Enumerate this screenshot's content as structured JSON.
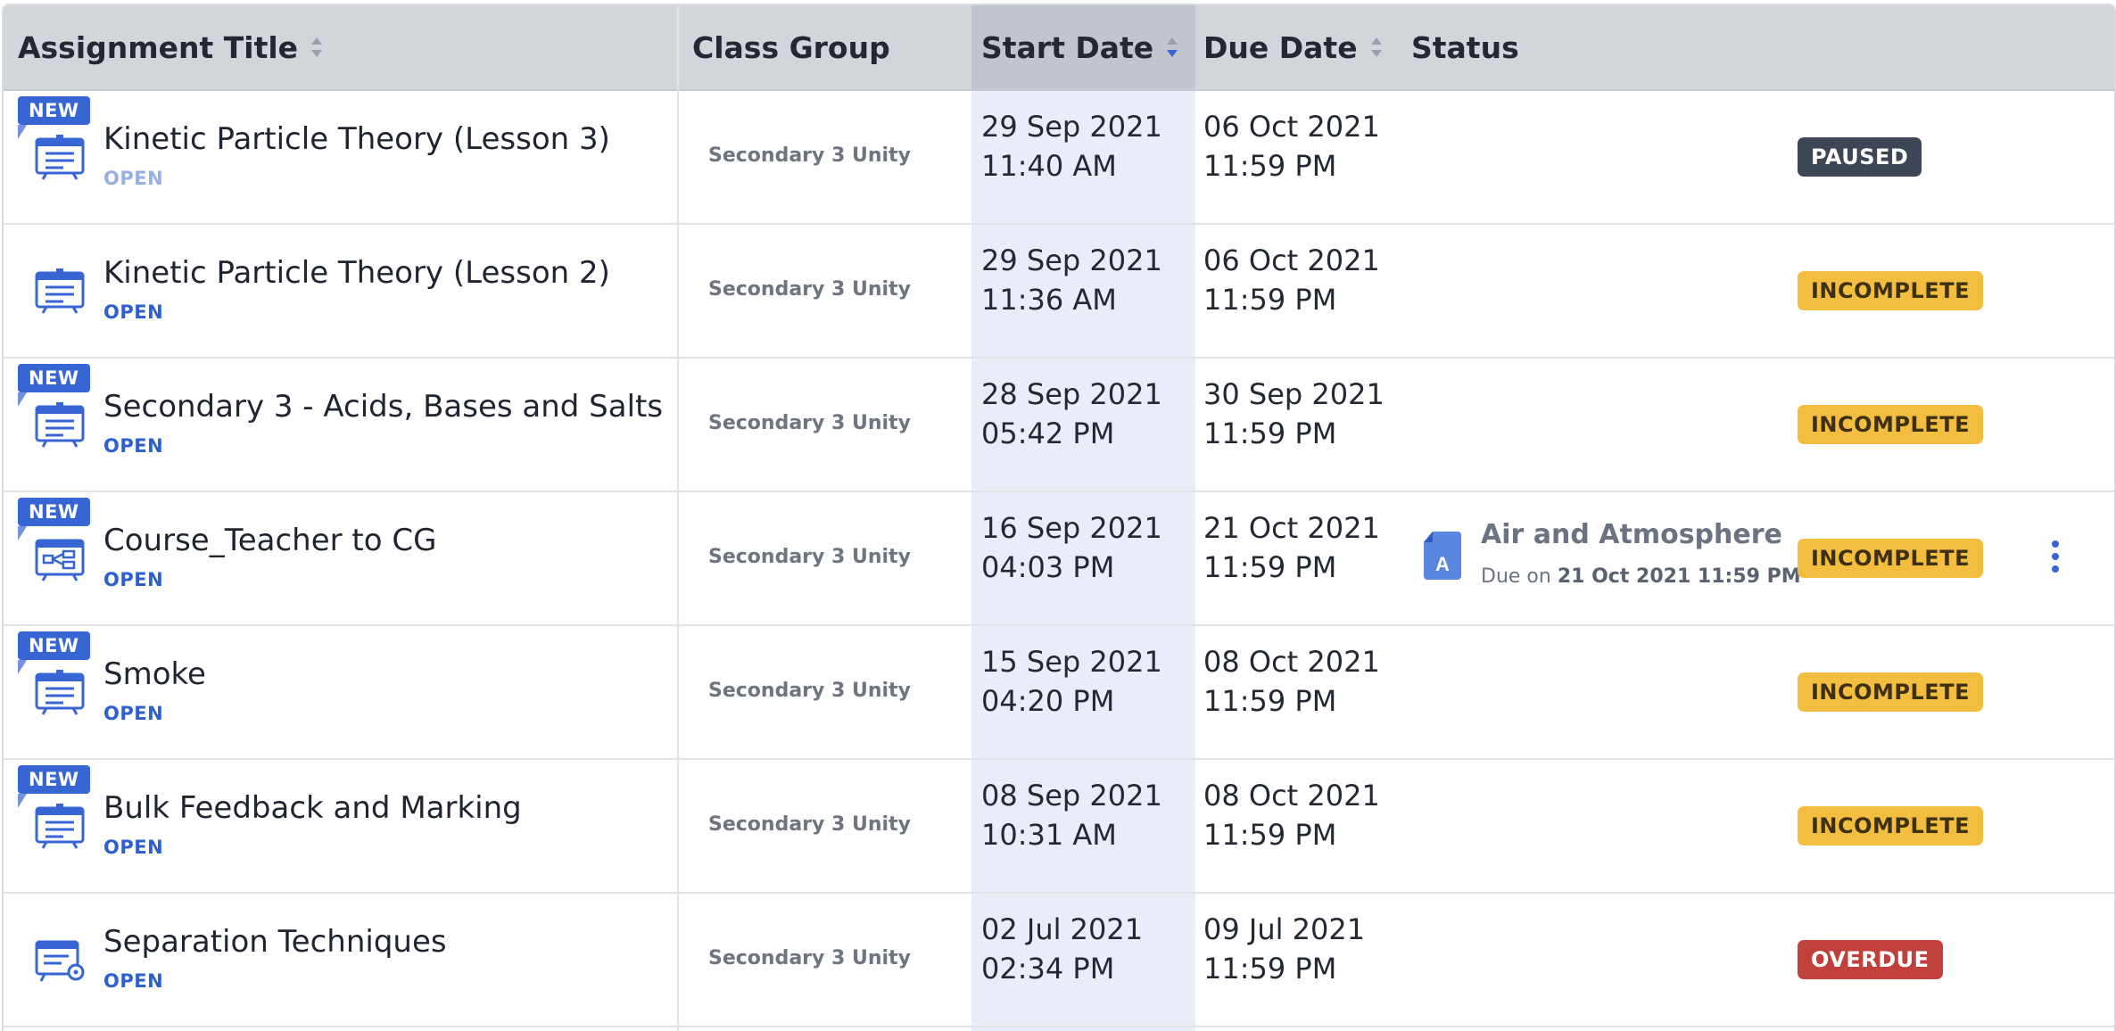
{
  "columns": {
    "title": "Assignment Title",
    "class_group": "Class Group",
    "start_date": "Start Date",
    "due_date": "Due Date",
    "status": "Status"
  },
  "sort": {
    "column": "start_date",
    "direction": "descending"
  },
  "colors": {
    "accent": "#3766d4",
    "paused": "#3d4656",
    "incomplete": "#f3bd3f",
    "overdue": "#c0403c",
    "header_bg": "#d2d6db",
    "sorted_column_bg": "#e8edf8"
  },
  "rows": [
    {
      "new_badge": "NEW",
      "icon": "assignment-board-icon",
      "title": "Kinetic Particle Theory (Lesson 3)",
      "state": "OPEN",
      "class_group": "Secondary 3 Unity",
      "start_date": "29 Sep 2021",
      "start_time": "11:40 AM",
      "due_date": "06 Oct 2021",
      "due_time": "11:59 PM",
      "status": "PAUSED"
    },
    {
      "new_badge": "",
      "icon": "assignment-board-icon",
      "title": "Kinetic Particle Theory (Lesson 2)",
      "state": "OPEN",
      "class_group": "Secondary 3 Unity",
      "start_date": "29 Sep 2021",
      "start_time": "11:36 AM",
      "due_date": "06 Oct 2021",
      "due_time": "11:59 PM",
      "status": "INCOMPLETE"
    },
    {
      "new_badge": "NEW",
      "icon": "assignment-board-icon",
      "title": "Secondary 3 - Acids, Bases and Salts",
      "state": "OPEN",
      "class_group": "Secondary 3 Unity",
      "start_date": "28 Sep 2021",
      "start_time": "05:42 PM",
      "due_date": "30 Sep 2021",
      "due_time": "11:59 PM",
      "status": "INCOMPLETE"
    },
    {
      "new_badge": "NEW",
      "icon": "course-flowchart-icon",
      "title": "Course_Teacher to CG",
      "state": "OPEN",
      "class_group": "Secondary 3 Unity",
      "start_date": "16 Sep 2021",
      "start_time": "04:03 PM",
      "due_date": "21 Oct 2021",
      "due_time": "11:59 PM",
      "status": "INCOMPLETE",
      "linked": {
        "icon": "document-a-icon",
        "doc_letter": "A",
        "title": "Air and Atmosphere",
        "due_prefix": "Due on",
        "due_value": "21 Oct 2021 11:59 PM"
      },
      "more_icon": "kebab-menu-icon"
    },
    {
      "new_badge": "NEW",
      "icon": "assignment-board-icon",
      "title": "Smoke",
      "state": "OPEN",
      "class_group": "Secondary 3 Unity",
      "start_date": "15 Sep 2021",
      "start_time": "04:20 PM",
      "due_date": "08 Oct 2021",
      "due_time": "11:59 PM",
      "status": "INCOMPLETE"
    },
    {
      "new_badge": "NEW",
      "icon": "assignment-board-icon",
      "title": "Bulk Feedback and Marking",
      "state": "OPEN",
      "class_group": "Secondary 3 Unity",
      "start_date": "08 Sep 2021",
      "start_time": "10:31 AM",
      "due_date": "08 Oct 2021",
      "due_time": "11:59 PM",
      "status": "INCOMPLETE"
    },
    {
      "new_badge": "",
      "icon": "assignment-board-gear-icon",
      "title": "Separation Techniques",
      "state": "OPEN",
      "class_group": "Secondary 3 Unity",
      "start_date": "02 Jul 2021",
      "start_time": "02:34 PM",
      "due_date": "09 Jul 2021",
      "due_time": "11:59 PM",
      "status": "OVERDUE"
    }
  ]
}
